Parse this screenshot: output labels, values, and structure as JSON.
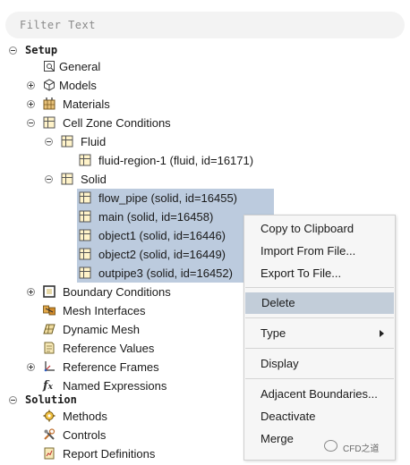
{
  "filter": {
    "placeholder": "Filter Text"
  },
  "tree": {
    "setup": "Setup",
    "general": "General",
    "models": "Models",
    "materials": "Materials",
    "cell_zone_conditions": "Cell Zone Conditions",
    "fluid": "Fluid",
    "fluid_region": "fluid-region-1 (fluid, id=16171)",
    "solid": "Solid",
    "solid_items": [
      "flow_pipe (solid, id=16455)",
      "main (solid, id=16458)",
      "object1 (solid, id=16446)",
      "object2 (solid, id=16449)",
      "outpipe3 (solid, id=16452)"
    ],
    "boundary_conditions": "Boundary Conditions",
    "mesh_interfaces": "Mesh Interfaces",
    "dynamic_mesh": "Dynamic Mesh",
    "reference_values": "Reference Values",
    "reference_frames": "Reference Frames",
    "named_expressions": "Named Expressions",
    "solution": "Solution",
    "methods": "Methods",
    "controls": "Controls",
    "report_definitions": "Report Definitions"
  },
  "context_menu": {
    "copy": "Copy to Clipboard",
    "import": "Import From File...",
    "export": "Export To File...",
    "delete": "Delete",
    "type": "Type",
    "display": "Display",
    "adjacent": "Adjacent Boundaries...",
    "deactivate": "Deactivate",
    "merge": "Merge"
  },
  "watermark": "CFD之道",
  "colors": {
    "selection": "#bccbde",
    "menu_highlight": "#c2cdd9"
  }
}
